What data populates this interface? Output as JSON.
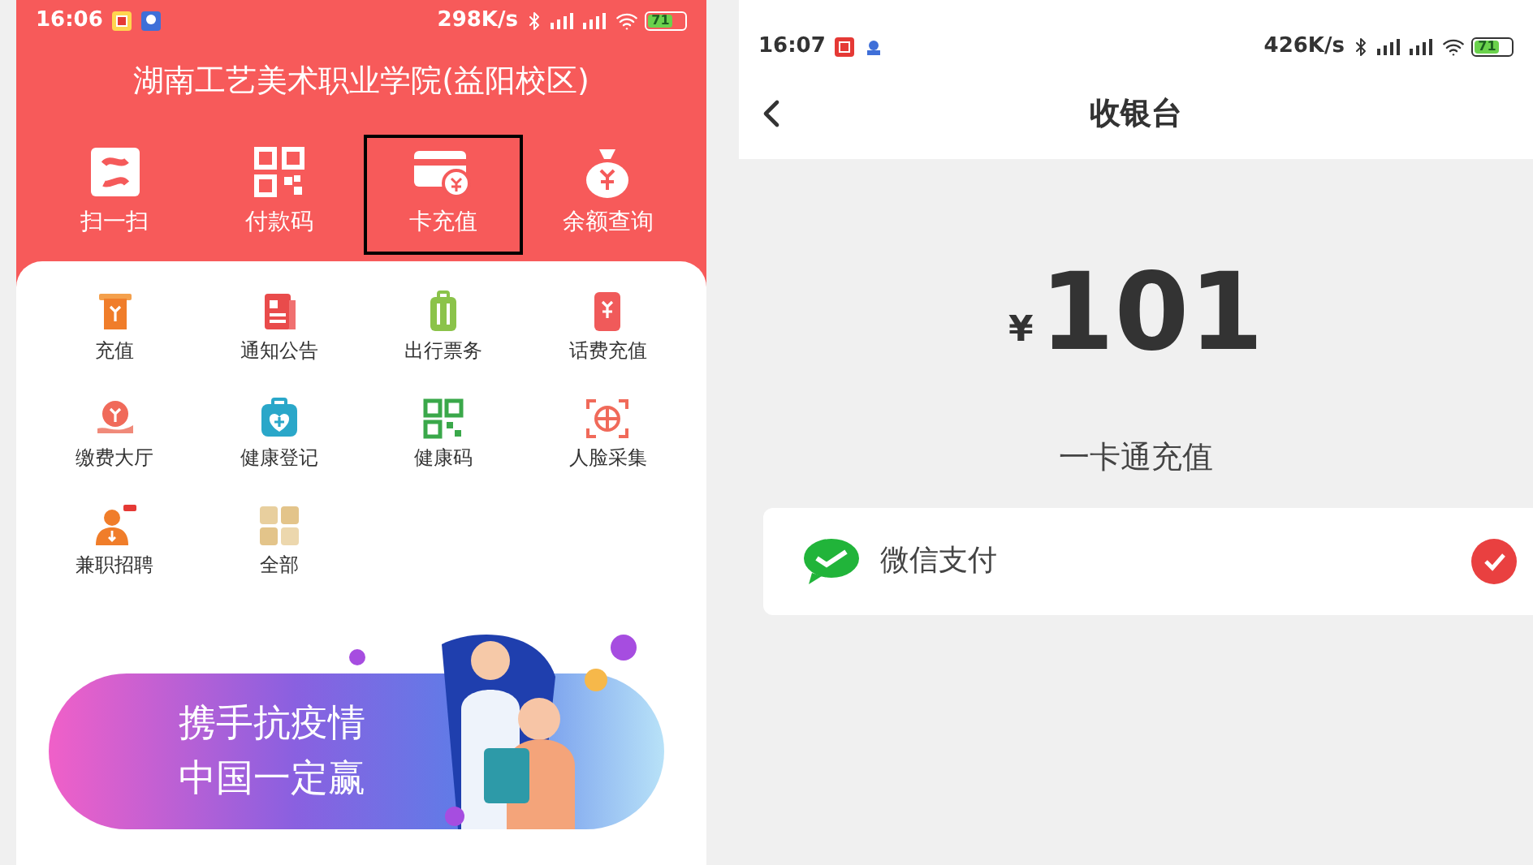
{
  "left": {
    "status_bar": {
      "time": "16:06",
      "speed": "298K/s",
      "battery": "71"
    },
    "title": "湖南工艺美术职业学院(益阳校区)",
    "quick_actions": [
      {
        "label": "扫一扫",
        "selected": false
      },
      {
        "label": "付款码",
        "selected": false
      },
      {
        "label": "卡充值",
        "selected": true
      },
      {
        "label": "余额查询",
        "selected": false
      }
    ],
    "services": [
      {
        "label": "充值"
      },
      {
        "label": "通知公告"
      },
      {
        "label": "出行票务"
      },
      {
        "label": "话费充值"
      },
      {
        "label": "缴费大厅"
      },
      {
        "label": "健康登记"
      },
      {
        "label": "健康码"
      },
      {
        "label": "人脸采集"
      },
      {
        "label": "兼职招聘"
      },
      {
        "label": "全部"
      }
    ],
    "banner": {
      "lines": [
        "携手抗疫情",
        "中国一定赢"
      ]
    }
  },
  "right": {
    "status_bar": {
      "time": "16:07",
      "speed": "426K/s",
      "battery": "71"
    },
    "title": "收银台",
    "amount": {
      "currency": "¥",
      "value": "101"
    },
    "description": "一卡通充值",
    "payment_methods": [
      {
        "label": "微信支付",
        "selected": true
      }
    ]
  }
}
